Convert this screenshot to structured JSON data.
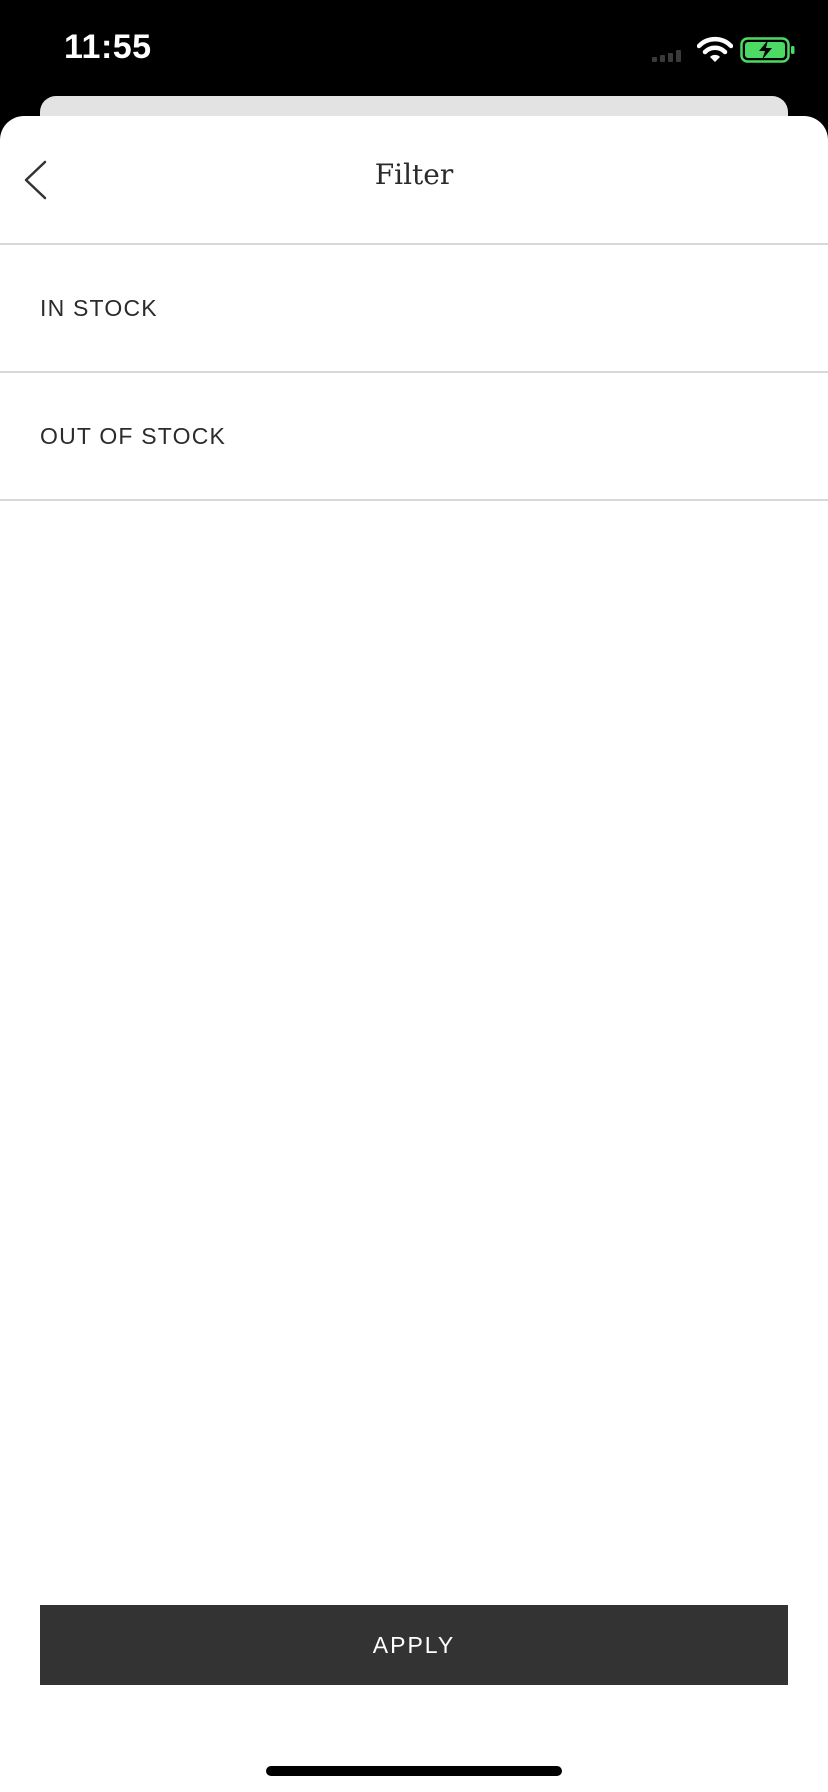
{
  "status_bar": {
    "time": "11:55",
    "icons": [
      "signal-icon",
      "wifi-icon",
      "battery-charging-icon"
    ],
    "battery_color": "#4cd964"
  },
  "header": {
    "title": "Filter",
    "back_icon": "chevron-left-icon"
  },
  "filters": [
    {
      "label": "IN STOCK"
    },
    {
      "label": "OUT OF STOCK"
    }
  ],
  "footer": {
    "apply_label": "APPLY",
    "apply_bg": "#333333"
  }
}
